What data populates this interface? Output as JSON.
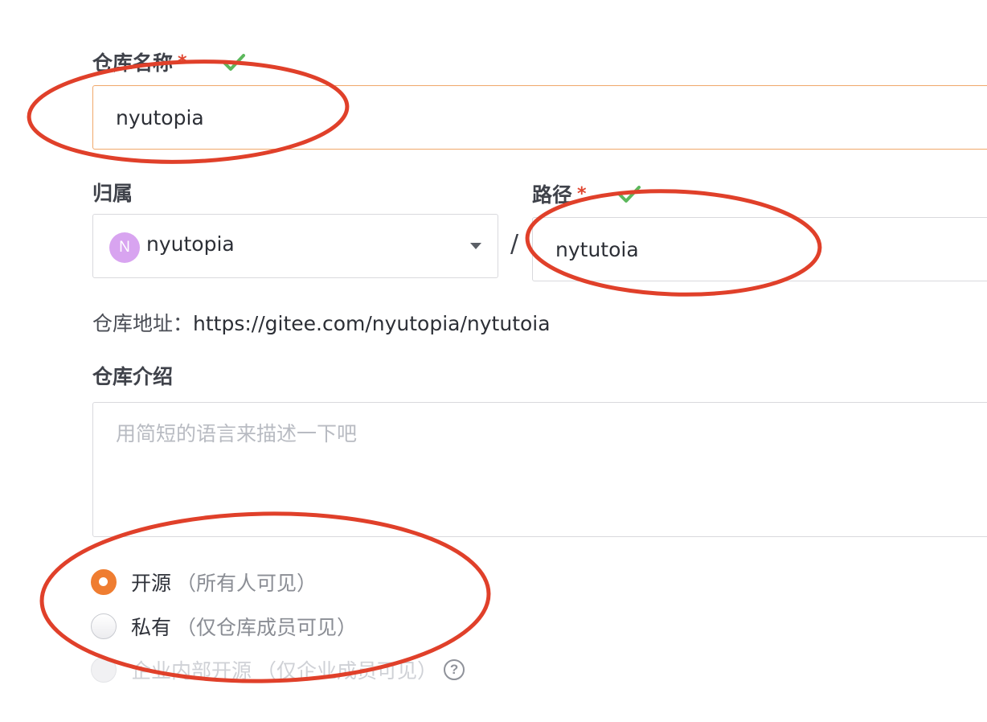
{
  "repo_name": {
    "label": "仓库名称",
    "required_mark": "*",
    "value": "nyutopia"
  },
  "owner": {
    "label": "归属",
    "avatar_letter": "N",
    "selected": "nyutopia"
  },
  "path": {
    "label": "路径",
    "required_mark": "*",
    "value": "nytutoia"
  },
  "separator": "/",
  "repo_url": {
    "prefix": "仓库地址：",
    "value": "https://gitee.com/nyutopia/nytutoia"
  },
  "description": {
    "label": "仓库介绍",
    "placeholder": "用简短的语言来描述一下吧"
  },
  "visibility": {
    "options": [
      {
        "label": "开源",
        "desc": "（所有人可见）",
        "checked": true,
        "disabled": false
      },
      {
        "label": "私有",
        "desc": "（仅仓库成员可见）",
        "checked": false,
        "disabled": false
      },
      {
        "label": "企业内部开源",
        "desc": "（仅企业成员可见）",
        "checked": false,
        "disabled": true
      }
    ]
  },
  "colors": {
    "accent": "#ef7d31",
    "annotation_red": "#e0402a",
    "valid_check": "#5cb85c"
  }
}
